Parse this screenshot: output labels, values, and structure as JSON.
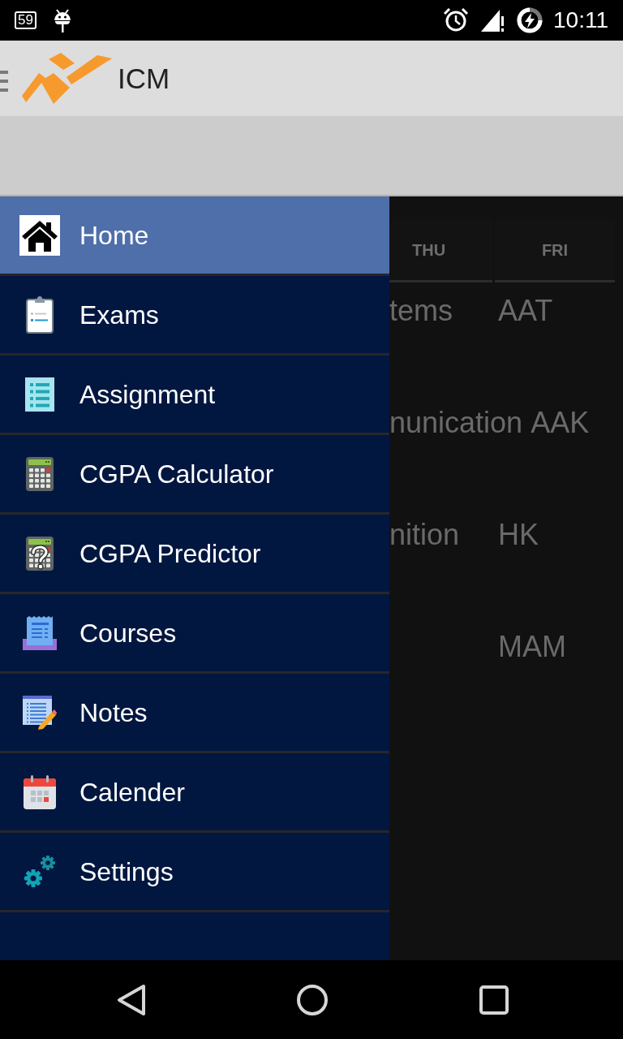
{
  "status_bar": {
    "badge": "59",
    "time": "10:11"
  },
  "app_bar": {
    "title": "ICM"
  },
  "timetable": {
    "columns": [
      "THU",
      "FRI"
    ],
    "rows": [
      {
        "thu": "tems",
        "fri": "AAT"
      },
      {
        "thu": "nunication",
        "fri": "AAK"
      },
      {
        "thu": "nition",
        "fri": "HK"
      },
      {
        "fri": "MAM"
      }
    ]
  },
  "drawer": {
    "items": [
      {
        "label": "Home",
        "kind": "home",
        "selected": true
      },
      {
        "label": "Exams",
        "kind": "exams",
        "selected": false
      },
      {
        "label": "Assignment",
        "kind": "assignment",
        "selected": false
      },
      {
        "label": "CGPA Calculator",
        "kind": "calculator",
        "selected": false
      },
      {
        "label": "CGPA Predictor",
        "kind": "predictor",
        "selected": false
      },
      {
        "label": "Courses",
        "kind": "courses",
        "selected": false
      },
      {
        "label": "Notes",
        "kind": "notes",
        "selected": false
      },
      {
        "label": "Calender",
        "kind": "calendar",
        "selected": false
      },
      {
        "label": "Settings",
        "kind": "settings",
        "selected": false
      }
    ]
  }
}
